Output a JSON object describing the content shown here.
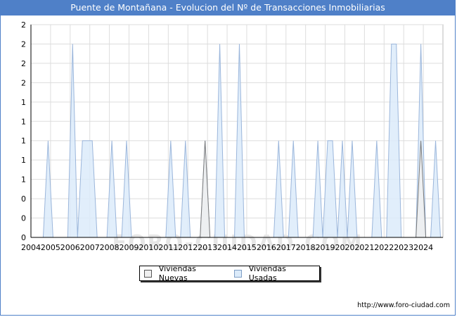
{
  "title": "Puente de Montañana - Evolucion del Nº de Transacciones Inmobiliarias",
  "source": "http://www.foro-ciudad.com",
  "watermark": "FORO-CIUDAD.COM",
  "colors": {
    "header_bg": "#4f80c8",
    "usadas_fill": "#dcebfa",
    "usadas_stroke": "#9bb6db",
    "nuevas_fill": "#eeeeee",
    "nuevas_stroke": "#7a7a7a",
    "grid": "#dddddd"
  },
  "chart_data": {
    "type": "area",
    "x_unit": "quarter",
    "x_range": [
      "2004-Q1",
      "2024-Q4"
    ],
    "xlim": [
      2004,
      2025
    ],
    "ylim": [
      0,
      2.2
    ],
    "y_tick_values": [
      0,
      0.2,
      0.4,
      0.6,
      0.8,
      1.0,
      1.2,
      1.4,
      1.6,
      1.8,
      2.0,
      2.2
    ],
    "y_tick_labels": [
      "0",
      "0",
      "0",
      "1",
      "1",
      "1",
      "1",
      "1",
      "2",
      "2",
      "2",
      "2"
    ],
    "x_tick_labels": [
      "2004",
      "2005",
      "2006",
      "2007",
      "2008",
      "2009",
      "2010",
      "2011",
      "2012",
      "2013",
      "2014",
      "2015",
      "2016",
      "2017",
      "2018",
      "2019",
      "2020",
      "2021",
      "2022",
      "2023",
      "2024"
    ],
    "grid": true,
    "legend_position": "bottom-center",
    "series": [
      {
        "name": "Viviendas Nuevas",
        "points": [
          [
            "2012-Q4",
            1
          ],
          [
            "2023-Q4",
            1
          ]
        ]
      },
      {
        "name": "Viviendas Usadas",
        "points": [
          [
            "2004-Q4",
            1
          ],
          [
            "2006-Q1",
            2
          ],
          [
            "2006-Q3",
            1
          ],
          [
            "2006-Q4",
            1
          ],
          [
            "2007-Q1",
            1
          ],
          [
            "2008-Q1",
            1
          ],
          [
            "2008-Q4",
            1
          ],
          [
            "2011-Q1",
            1
          ],
          [
            "2011-Q4",
            1
          ],
          [
            "2012-Q4",
            1
          ],
          [
            "2013-Q3",
            2
          ],
          [
            "2014-Q3",
            2
          ],
          [
            "2016-Q3",
            1
          ],
          [
            "2017-Q2",
            1
          ],
          [
            "2018-Q3",
            1
          ],
          [
            "2019-Q1",
            1
          ],
          [
            "2019-Q2",
            1
          ],
          [
            "2019-Q4",
            1
          ],
          [
            "2020-Q2",
            1
          ],
          [
            "2021-Q3",
            1
          ],
          [
            "2022-Q2",
            2
          ],
          [
            "2022-Q3",
            2
          ],
          [
            "2023-Q4",
            2
          ],
          [
            "2024-Q3",
            1
          ]
        ]
      }
    ]
  }
}
